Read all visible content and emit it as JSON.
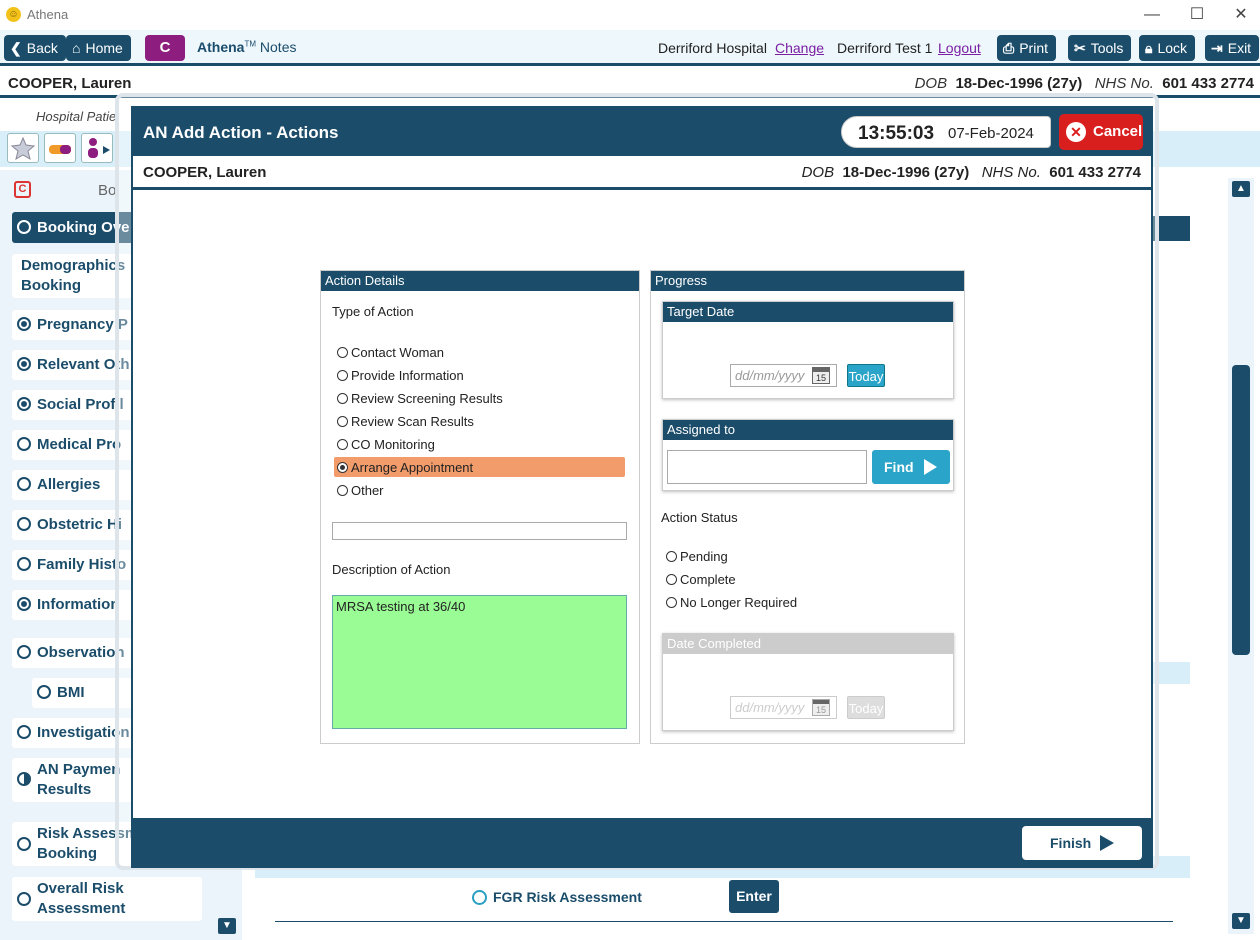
{
  "app": {
    "title": "Athena"
  },
  "toolbar": {
    "back_label": "Back",
    "home_label": "Home",
    "c_label": "C",
    "brand_name": "Athena",
    "brand_tm": "TM",
    "brand_sub": "Notes",
    "hospital": "Derriford Hospital",
    "change_label": "Change",
    "user": "Derriford Test 1",
    "logout_label": "Logout",
    "print_label": "Print",
    "tools_label": "Tools",
    "lock_label": "Lock",
    "exit_label": "Exit"
  },
  "patient": {
    "name": "COOPER, Lauren",
    "dob_label": "DOB",
    "dob": "18-Dec-1996 (27y)",
    "nhs_label": "NHS No.",
    "nhs": "601 433 2774"
  },
  "subbar": {
    "hospital_patient": "Hospital Patie"
  },
  "sidebar": {
    "header_fragment": "Bo",
    "items": [
      {
        "label": "Booking Ove",
        "state": "active"
      },
      {
        "label": "Demographics",
        "label2": "Booking",
        "state": "none"
      },
      {
        "label": "Pregnancy P",
        "state": "filled"
      },
      {
        "label": "Relevant Oth",
        "state": "filled"
      },
      {
        "label": "Social Profil",
        "state": "filled"
      },
      {
        "label": "Medical Pro",
        "state": "empty"
      },
      {
        "label": "Allergies",
        "state": "empty"
      },
      {
        "label": "Obstetric Hi",
        "state": "empty"
      },
      {
        "label": "Family Histo",
        "state": "empty"
      },
      {
        "label": "Information",
        "state": "filled"
      },
      {
        "label": "Observation",
        "state": "empty"
      },
      {
        "label": "BMI",
        "state": "empty"
      },
      {
        "label": "Investigation",
        "state": "empty"
      },
      {
        "label": "AN Paymen",
        "label2": "Results",
        "state": "half"
      },
      {
        "label": "Risk Assessm",
        "label2": "Booking",
        "state": "empty"
      },
      {
        "label": "Overall Risk",
        "label2": "Assessment",
        "state": "empty"
      }
    ]
  },
  "background": {
    "fgr_label": "FGR Risk Assessment",
    "enter_label": "Enter"
  },
  "modal": {
    "title": "AN Add Action - Actions",
    "time": "13:55:03",
    "date": "07-Feb-2024",
    "cancel_label": "Cancel",
    "finish_label": "Finish",
    "action_details": {
      "header": "Action Details",
      "type_label": "Type of Action",
      "options": [
        {
          "label": "Contact Woman",
          "selected": false
        },
        {
          "label": "Provide Information",
          "selected": false
        },
        {
          "label": "Review Screening Results",
          "selected": false
        },
        {
          "label": "Review Scan Results",
          "selected": false
        },
        {
          "label": "CO Monitoring",
          "selected": false
        },
        {
          "label": "Arrange Appointment",
          "selected": true
        },
        {
          "label": "Other",
          "selected": false
        }
      ],
      "other_value": "",
      "description_label": "Description of Action",
      "description_value": "MRSA testing at 36/40"
    },
    "progress": {
      "header": "Progress",
      "target_date": {
        "header": "Target Date",
        "placeholder": "dd/mm/yyyy",
        "today_label": "Today"
      },
      "assigned_to": {
        "header": "Assigned to",
        "value": "",
        "find_label": "Find"
      },
      "status_label": "Action Status",
      "status_options": [
        {
          "label": "Pending",
          "selected": false
        },
        {
          "label": "Complete",
          "selected": false
        },
        {
          "label": "No Longer Required",
          "selected": false
        }
      ],
      "date_completed": {
        "header": "Date Completed",
        "placeholder": "dd/mm/yyyy",
        "today_label": "Today"
      }
    }
  },
  "icons": {
    "calendar_day": "15"
  },
  "colors": {
    "primary": "#1b4d6b",
    "accent": "#2aa5c9",
    "cancel": "#d91e1e",
    "highlight": "#f39c6b",
    "description_bg": "#9afc94"
  }
}
